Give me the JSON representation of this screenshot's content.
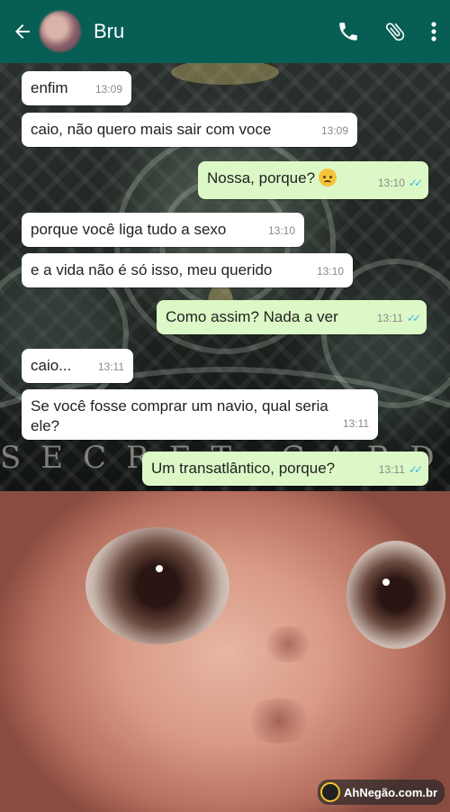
{
  "header": {
    "contact_name": "Bru",
    "icons": [
      "back-arrow-icon",
      "phone-icon",
      "attachment-icon",
      "more-vert-icon"
    ]
  },
  "wallpaper_text": "SECRET GARDEN",
  "messages": [
    {
      "direction": "in",
      "text": "enfim",
      "time": "13:09"
    },
    {
      "direction": "in",
      "text": "caio, não quero mais sair com voce",
      "time": "13:09"
    },
    {
      "direction": "out",
      "text": "Nossa, porque?",
      "emoji": "anxious-face",
      "time": "13:10",
      "status": "read"
    },
    {
      "direction": "in",
      "text": "porque você liga tudo a sexo",
      "time": "13:10"
    },
    {
      "direction": "in",
      "text": "e a vida não é só isso, meu querido",
      "time": "13:10"
    },
    {
      "direction": "out",
      "text": "Como assim? Nada a ver",
      "time": "13:11",
      "status": "read"
    },
    {
      "direction": "in",
      "text": "caio...",
      "time": "13:11"
    },
    {
      "direction": "in",
      "text": "Se você fosse comprar um navio, qual seria ele?",
      "time": "13:11"
    },
    {
      "direction": "out",
      "text": "Um transatlântico, porque?",
      "time": "13:11",
      "status": "read"
    }
  ],
  "watermark": "AhNegão.com.br",
  "colors": {
    "header": "#075e54",
    "bubble_in": "#ffffff",
    "bubble_out": "#dcf8c6",
    "read_ticks": "#34b7f1"
  }
}
